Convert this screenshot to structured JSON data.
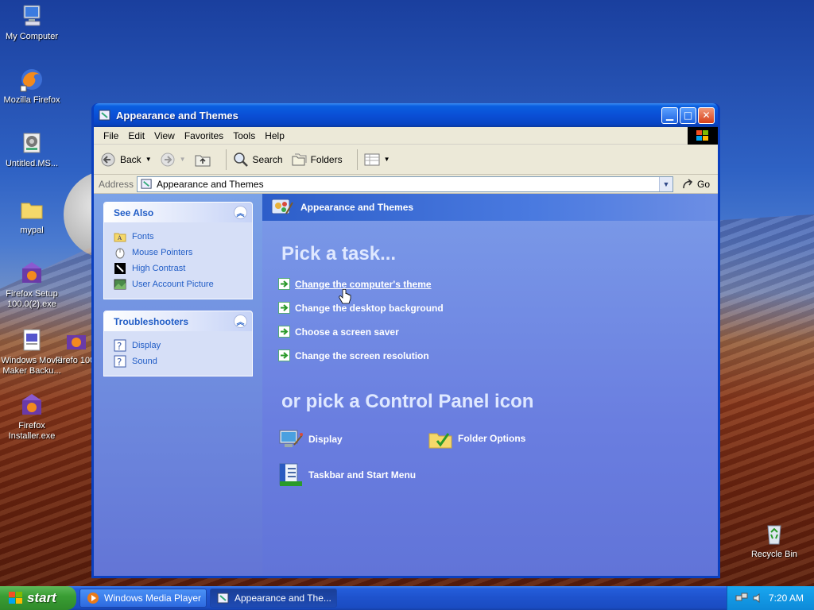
{
  "desktop": {
    "icons": [
      {
        "label": "My Computer",
        "icon": "my-computer-icon"
      },
      {
        "label": "Mozilla Firefox",
        "icon": "firefox-icon"
      },
      {
        "label": "Untitled.MS...",
        "icon": "movie-file-icon"
      },
      {
        "label": "mypal",
        "icon": "folder-icon"
      },
      {
        "label": "Firefox Setup 100.0(2).exe",
        "icon": "firefox-setup-icon"
      },
      {
        "label": "Windows Movie Maker Backu...",
        "icon": "movie-maker-backup-icon"
      },
      {
        "label": "Firefox Installer.exe",
        "icon": "firefox-installer-icon"
      },
      {
        "label": "Firefo 100.",
        "icon": "firefox-setup-icon"
      },
      {
        "label": "Recycle Bin",
        "icon": "recycle-bin-icon"
      }
    ]
  },
  "window": {
    "title": "Appearance and Themes",
    "menu": [
      "File",
      "Edit",
      "View",
      "Favorites",
      "Tools",
      "Help"
    ],
    "toolbar": {
      "back_label": "Back",
      "search_label": "Search",
      "folders_label": "Folders"
    },
    "address": {
      "label": "Address",
      "value": "Appearance and Themes",
      "go_label": "Go"
    }
  },
  "sidebar": {
    "see_also": {
      "title": "See Also",
      "items": [
        {
          "label": "Fonts",
          "icon": "fonts-folder-icon"
        },
        {
          "label": "Mouse Pointers",
          "icon": "mouse-icon"
        },
        {
          "label": "High Contrast",
          "icon": "high-contrast-icon"
        },
        {
          "label": "User Account Picture",
          "icon": "user-picture-icon"
        }
      ]
    },
    "troubleshooters": {
      "title": "Troubleshooters",
      "items": [
        {
          "label": "Display",
          "icon": "help-icon"
        },
        {
          "label": "Sound",
          "icon": "help-icon"
        }
      ]
    }
  },
  "main": {
    "header": "Appearance and Themes",
    "pick_task": "Pick a task...",
    "tasks": [
      "Change the computer's theme",
      "Change the desktop background",
      "Choose a screen saver",
      "Change the screen resolution"
    ],
    "pick_icon": "or pick a Control Panel icon",
    "icons": [
      {
        "label": "Display",
        "icon": "display-icon"
      },
      {
        "label": "Folder Options",
        "icon": "folder-options-icon"
      },
      {
        "label": "Taskbar and Start Menu",
        "icon": "taskbar-start-menu-icon"
      }
    ]
  },
  "taskbar": {
    "start_label": "start",
    "buttons": [
      {
        "label": "Windows Media Player",
        "icon": "media-player-icon"
      },
      {
        "label": "Appearance and The...",
        "icon": "control-panel-icon"
      }
    ],
    "clock": "7:20 AM"
  }
}
